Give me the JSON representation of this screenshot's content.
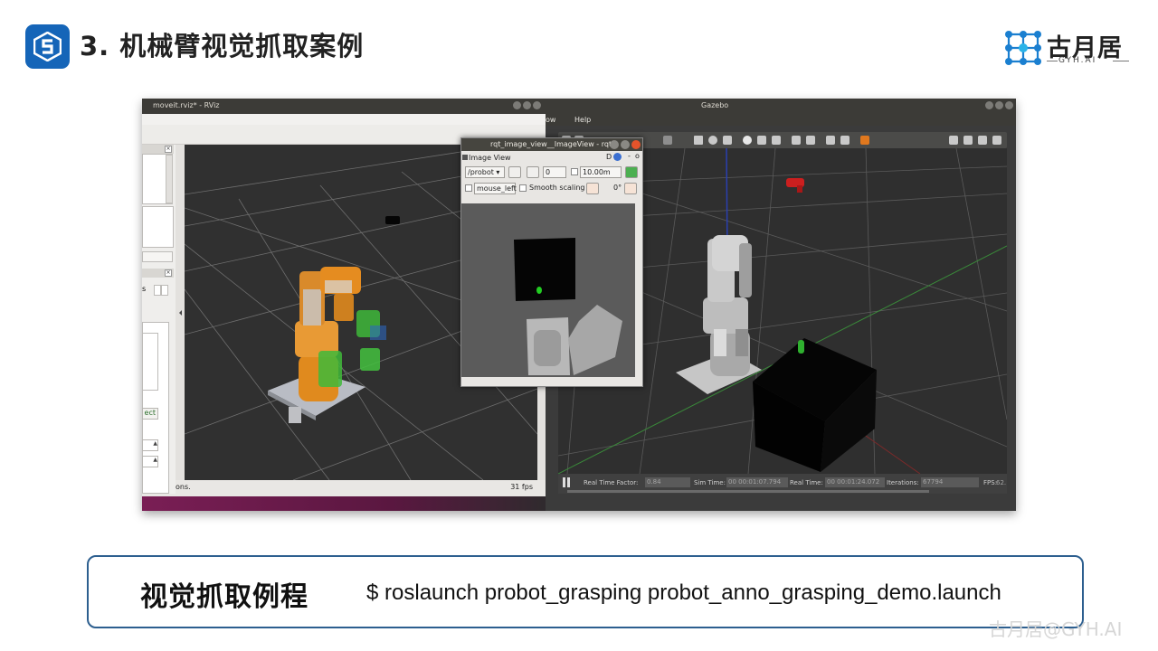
{
  "slide": {
    "title": "3. 机械臂视觉抓取案例",
    "brand_name": "古月居",
    "brand_sub": "GYH.AI"
  },
  "rviz": {
    "window_title": "moveit.rviz* - RViz",
    "status_left": "ons.",
    "fps": "31 fps",
    "partial_button": "ect"
  },
  "gazebo": {
    "window_title": "Gazebo",
    "menu_partial": "ow",
    "menu_help": "Help",
    "real_time_factor_label": "Real Time Factor:",
    "real_time_factor": "0.84",
    "sim_time_label": "Sim Time:",
    "sim_time": "00 00:01:07.794",
    "real_time_label": "Real Time:",
    "real_time": "00 00:01:24.072",
    "iterations_label": "Iterations:",
    "iterations": "67794",
    "fps_label": "FPS:",
    "fps": "62."
  },
  "rqt": {
    "window_title": "rqt_image_view__ImageView - rqt",
    "panel_title": "Image View",
    "panel_flags": "D",
    "topic": "/probot",
    "spin_value": "0",
    "max_range": "10.00m",
    "mouse_topic": "mouse_left",
    "smooth_label": "Smooth scaling",
    "rotation": "0°"
  },
  "command": {
    "label": "视觉抓取例程",
    "text": "$ roslaunch probot_grasping probot_anno_grasping_demo.launch"
  },
  "watermark": "古月居@GYH.AI",
  "colors": {
    "accent_blue": "#1565b8",
    "box_border": "#2d5f8f",
    "robot_orange": "#e08a1e",
    "planned_green": "#3fb83a"
  }
}
